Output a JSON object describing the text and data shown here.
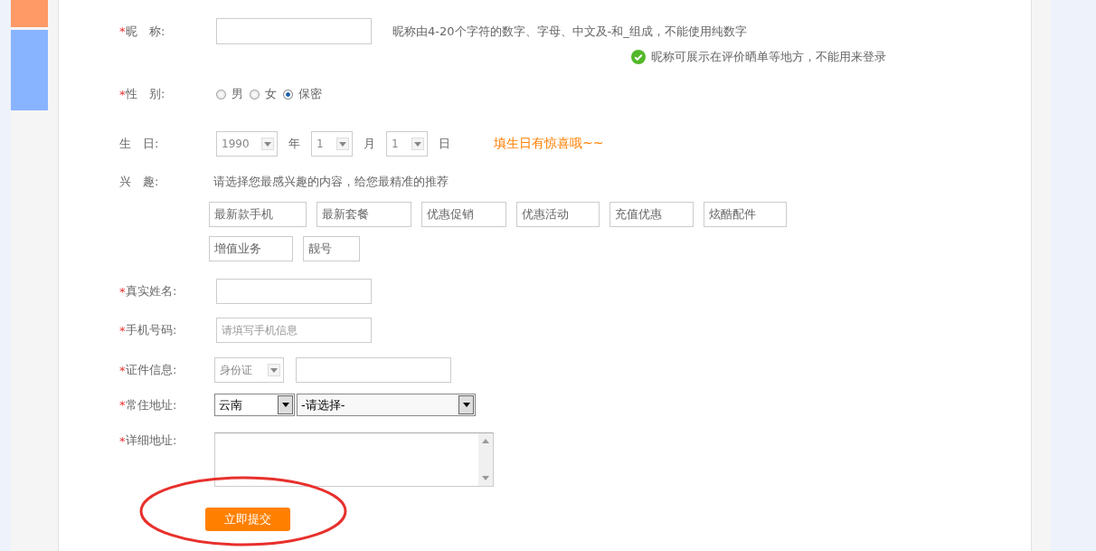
{
  "nickname": {
    "marker": "*",
    "label": "昵　称:",
    "hint": "昵称由4-20个字符的数字、字母、中文及-和_组成，不能使用纯数字",
    "note": "昵称可展示在评价晒单等地方，不能用来登录"
  },
  "gender": {
    "marker": "*",
    "label": "性　别:",
    "options": [
      {
        "label": "男",
        "selected": false
      },
      {
        "label": "女",
        "selected": false
      },
      {
        "label": "保密",
        "selected": true
      }
    ]
  },
  "birthday": {
    "label": "生　日:",
    "parts": [
      {
        "value": "1990",
        "unit": "年"
      },
      {
        "value": "1",
        "unit": "月"
      },
      {
        "value": "1",
        "unit": "日"
      }
    ],
    "promo": "填生日有惊喜哦~~"
  },
  "interests": {
    "label": "兴　趣:",
    "prompt": "请选择您最感兴趣的内容，给您最精准的推荐",
    "tags": [
      "最新款手机",
      "最新套餐",
      "优惠促销",
      "优惠活动",
      "充值优惠",
      "炫酷配件",
      "增值业务",
      "靓号"
    ]
  },
  "real_name": {
    "marker": "*",
    "label": "真实姓名:"
  },
  "phone": {
    "marker": "*",
    "label": "手机号码:",
    "placeholder": "请填写手机信息"
  },
  "id_info": {
    "marker": "*",
    "label": "证件信息:",
    "type": "身份证"
  },
  "address": {
    "marker": "*",
    "label": "常住地址:",
    "province": "云南",
    "city": "-请选择-"
  },
  "detail_address": {
    "marker": "*",
    "label": "详细地址:"
  },
  "submit": {
    "label": "立即提交"
  }
}
